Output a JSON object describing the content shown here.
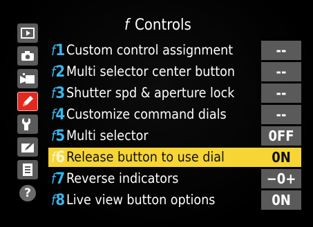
{
  "menu": {
    "title_prefix": "f",
    "title": "Controls"
  },
  "sidebar": {
    "tabs": [
      {
        "name": "playback-menu",
        "icon": "playback-icon",
        "active": false
      },
      {
        "name": "photo-shooting-menu",
        "icon": "camera-icon",
        "active": false
      },
      {
        "name": "movie-shooting-menu",
        "icon": "movie-camera-icon",
        "active": false
      },
      {
        "name": "custom-settings-menu",
        "icon": "pencil-icon",
        "active": true
      },
      {
        "name": "setup-menu",
        "icon": "wrench-icon",
        "active": false
      },
      {
        "name": "retouch-menu",
        "icon": "retouch-brush-icon",
        "active": false
      },
      {
        "name": "my-menu",
        "icon": "my-menu-icon",
        "active": false
      }
    ],
    "help": "?"
  },
  "rows": [
    {
      "prefix": "f",
      "number": "1",
      "label": "Custom control assignment",
      "value": "--"
    },
    {
      "prefix": "f",
      "number": "2",
      "label": "Multi selector center button",
      "value": "--"
    },
    {
      "prefix": "f",
      "number": "3",
      "label": "Shutter spd & aperture lock",
      "value": "--"
    },
    {
      "prefix": "f",
      "number": "4",
      "label": "Customize command dials",
      "value": "--"
    },
    {
      "prefix": "f",
      "number": "5",
      "label": "Multi selector",
      "value": "0FF"
    },
    {
      "prefix": "f",
      "number": "6",
      "label": "Release button to use dial",
      "value": "0N"
    },
    {
      "prefix": "f",
      "number": "7",
      "label": "Reverse indicators",
      "value": "−0+"
    },
    {
      "prefix": "f",
      "number": "8",
      "label": "Live view button options",
      "value": "0N"
    }
  ],
  "colors": {
    "highlight": "#f6d535",
    "active_tab": "#e02a20",
    "item_number": "#39b6ec",
    "value_box": "#5a5a5a"
  }
}
